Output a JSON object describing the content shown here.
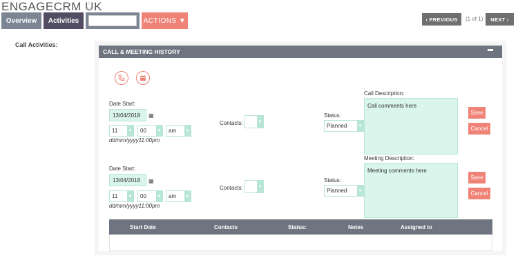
{
  "header": {
    "title": "ENGAGECRM UK"
  },
  "tabs": [
    {
      "label": "Overview"
    },
    {
      "label": "Activities"
    },
    {
      "label": ""
    },
    {
      "label": "ACTIONS ▼"
    }
  ],
  "pagination": {
    "previous": "‹ PREVIOUS",
    "count": "(1 of 1)",
    "next": "NEXT ›"
  },
  "section_label": "Call Activities:",
  "panel": {
    "title": "CALL & MEETING HISTORY"
  },
  "call": {
    "date_label": "Date Start:",
    "date": "13/04/2018",
    "hour": "11",
    "minute": "00",
    "ampm": "am",
    "format_hint": "dd/mm/yyyy11:00pm",
    "contacts_label": "Contacts:",
    "status_label": "Status:",
    "status": "Planned",
    "desc_label": "Call Description:",
    "desc_placeholder": "Call comments here",
    "save": "Save",
    "cancel": "Cancel"
  },
  "meeting": {
    "date_label": "Date Start:",
    "date": "13/04/2018",
    "hour": "11",
    "minute": "00",
    "ampm": "am",
    "format_hint": "dd/mm/yyyy11:00pm",
    "contacts_label": "Contacts:",
    "status_label": "Status:",
    "status": "Planned",
    "desc_label": "Meeting Description:",
    "desc_placeholder": "Meeting comments here",
    "save": "Save",
    "cancel": "Cancel"
  },
  "table": {
    "columns": [
      "Start Date",
      "Contacts",
      "Status:",
      "Notes",
      "Assigned to"
    ]
  },
  "icons": {
    "phone": "phone-icon",
    "meeting": "calendar-icon",
    "star": "star-icon"
  }
}
